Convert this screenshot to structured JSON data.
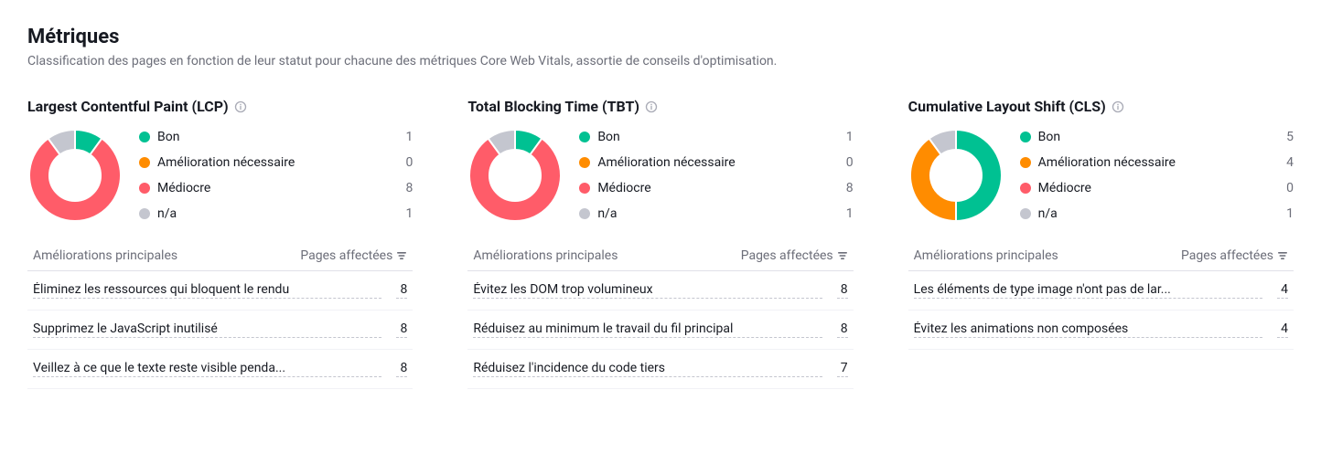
{
  "header": {
    "title": "Métriques",
    "subtitle": "Classification des pages en fonction de leur statut pour chacune des métriques Core Web Vitals, assortie de conseils d'optimisation."
  },
  "colors": {
    "good": "#00c192",
    "needs_improvement": "#ff8c00",
    "poor": "#ff5c69",
    "na": "#c4c6cf"
  },
  "legend_labels": {
    "good": "Bon",
    "needs_improvement": "Amélioration nécessaire",
    "poor": "Médiocre",
    "na": "n/a"
  },
  "table_headers": {
    "improvement": "Améliorations principales",
    "pages": "Pages affectées"
  },
  "chart_data": [
    {
      "type": "pie",
      "title": "Largest Contentful Paint (LCP)",
      "categories": [
        "Bon",
        "Amélioration nécessaire",
        "Médiocre",
        "n/a"
      ],
      "values": [
        1,
        0,
        8,
        1
      ]
    },
    {
      "type": "pie",
      "title": "Total Blocking Time (TBT)",
      "categories": [
        "Bon",
        "Amélioration nécessaire",
        "Médiocre",
        "n/a"
      ],
      "values": [
        1,
        0,
        8,
        1
      ]
    },
    {
      "type": "pie",
      "title": "Cumulative Layout Shift (CLS)",
      "categories": [
        "Bon",
        "Amélioration nécessaire",
        "Médiocre",
        "n/a"
      ],
      "values": [
        5,
        4,
        0,
        1
      ]
    }
  ],
  "metrics": [
    {
      "id": "lcp",
      "title": "Largest Contentful Paint (LCP)",
      "segments": {
        "good": 1,
        "needs_improvement": 0,
        "poor": 8,
        "na": 1
      },
      "improvements": [
        {
          "label": "Éliminez les ressources qui bloquent le rendu",
          "pages": 8
        },
        {
          "label": "Supprimez le JavaScript inutilisé",
          "pages": 8
        },
        {
          "label": "Veillez à ce que le texte reste visible penda...",
          "pages": 8
        }
      ]
    },
    {
      "id": "tbt",
      "title": "Total Blocking Time (TBT)",
      "segments": {
        "good": 1,
        "needs_improvement": 0,
        "poor": 8,
        "na": 1
      },
      "improvements": [
        {
          "label": "Évitez les DOM trop volumineux",
          "pages": 8
        },
        {
          "label": "Réduisez au minimum le travail du fil principal",
          "pages": 8
        },
        {
          "label": "Réduisez l'incidence du code tiers",
          "pages": 7
        }
      ]
    },
    {
      "id": "cls",
      "title": "Cumulative Layout Shift (CLS)",
      "segments": {
        "good": 5,
        "needs_improvement": 4,
        "poor": 0,
        "na": 1
      },
      "improvements": [
        {
          "label": "Les éléments de type image n'ont pas de lar...",
          "pages": 4
        },
        {
          "label": "Évitez les animations non composées",
          "pages": 4
        }
      ]
    }
  ]
}
